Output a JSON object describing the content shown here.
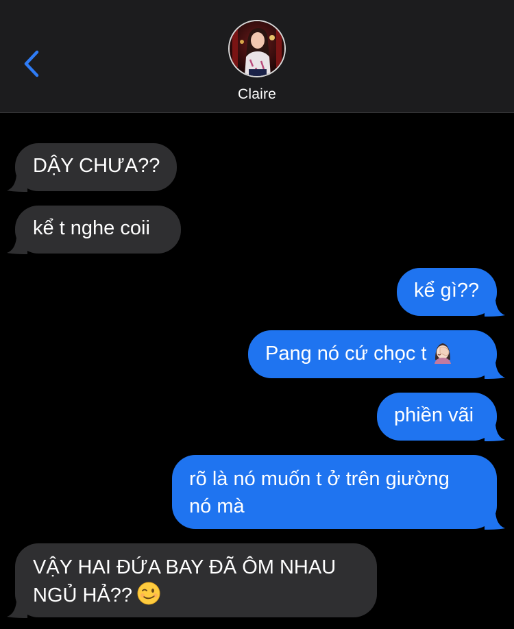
{
  "header": {
    "back_icon": "chevron-left-icon",
    "contact_name": "Claire",
    "avatar": "contact-avatar-photo",
    "accent_color": "#2f7cf6"
  },
  "messages": [
    {
      "direction": "incoming",
      "text": "DẬY CHƯA??"
    },
    {
      "direction": "incoming",
      "text": "kể t nghe coii"
    },
    {
      "direction": "outgoing",
      "text": "kể gì??"
    },
    {
      "direction": "outgoing",
      "text": "Pang nó cứ chọc t",
      "emoji": "woman-facepalming-emoji"
    },
    {
      "direction": "outgoing",
      "text": "phiền vãi"
    },
    {
      "direction": "outgoing",
      "lines": [
        "rõ là nó muốn t ở trên giường",
        "nó mà"
      ]
    },
    {
      "direction": "incoming",
      "lines": [
        "VẬY HAI ĐỨA BAY ĐÃ ÔM NHAU",
        "NGỦ HẢ??"
      ],
      "emoji": "winking-face-emoji"
    }
  ],
  "colors": {
    "incoming_bubble": "#2f2f31",
    "outgoing_bubble": "#1f74f0",
    "header_bg": "#1c1c1e",
    "background": "#000000"
  }
}
